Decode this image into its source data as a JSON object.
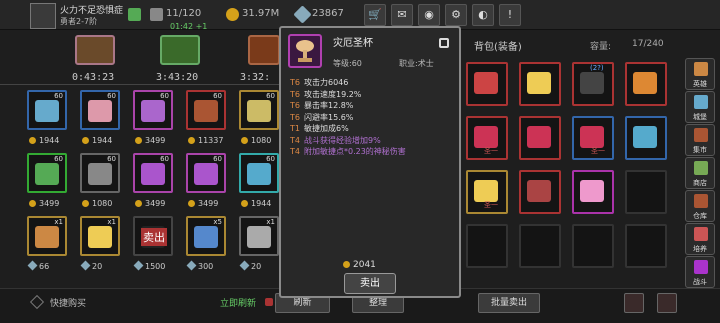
{
  "player": {
    "name": "火力不足恐惧症",
    "rank": "勇者2-7阶"
  },
  "topbar": {
    "bag": "11/120",
    "bag_sub": "01:42 +1",
    "gold": "31.97M",
    "gems": "23867"
  },
  "chests": [
    {
      "time": "0:43:23"
    },
    {
      "time": "3:43:20"
    },
    {
      "time": "3:32:"
    }
  ],
  "shop": {
    "rows": [
      [
        {
          "level": "60",
          "price": "1944"
        },
        {
          "level": "60",
          "price": "1944"
        },
        {
          "level": "60",
          "price": "3499"
        },
        {
          "level": "60",
          "price": "11337"
        },
        {
          "level": "60",
          "price": "1080"
        }
      ],
      [
        {
          "level": "60",
          "price": "3499"
        },
        {
          "level": "60",
          "price": "1080"
        },
        {
          "level": "60",
          "price": "3499"
        },
        {
          "level": "60",
          "price": "3499"
        },
        {
          "level": "60",
          "price": "1944"
        }
      ],
      [
        {
          "level": "x1",
          "price": "66"
        },
        {
          "level": "x1",
          "price": "20"
        },
        {
          "level": "",
          "price": "1500",
          "overlay": "卖出"
        },
        {
          "level": "x5",
          "price": "300"
        },
        {
          "level": "x1",
          "price": "20"
        }
      ]
    ]
  },
  "bag": {
    "title": "背包(装备)",
    "capacity_label": "容量:",
    "capacity": "17/240",
    "badge": "(2?)",
    "tag": "圣一"
  },
  "tooltip": {
    "name": "灾厄圣杯",
    "level": "等级:60",
    "job": "职业:术士",
    "stats": [
      {
        "tier": "T6",
        "text": "攻击力6046"
      },
      {
        "tier": "T6",
        "text": "攻击速度19.2%"
      },
      {
        "tier": "T6",
        "text": "暴击率12.8%"
      },
      {
        "tier": "T6",
        "text": "闪避率15.6%"
      },
      {
        "tier": "T1",
        "text": "敏捷加成6%"
      },
      {
        "tier": "T4",
        "text": "战斗获得经验增加9%"
      },
      {
        "tier": "T4",
        "text": "附加敏捷点*0.23的神秘伤害"
      }
    ],
    "price": "2041",
    "sell": "卖出"
  },
  "sidebar": [
    "英雄",
    "城堡",
    "集市",
    "商店",
    "仓库",
    "培养",
    "战斗"
  ],
  "bottom": {
    "quick_buy": "快捷购买",
    "refresh_now": "立即刷新",
    "refresh": "刷新",
    "sort": "整理",
    "bulk_sell": "批量卖出"
  },
  "colors": {
    "purple_stat": "#b070d0",
    "tier": "#d84"
  }
}
